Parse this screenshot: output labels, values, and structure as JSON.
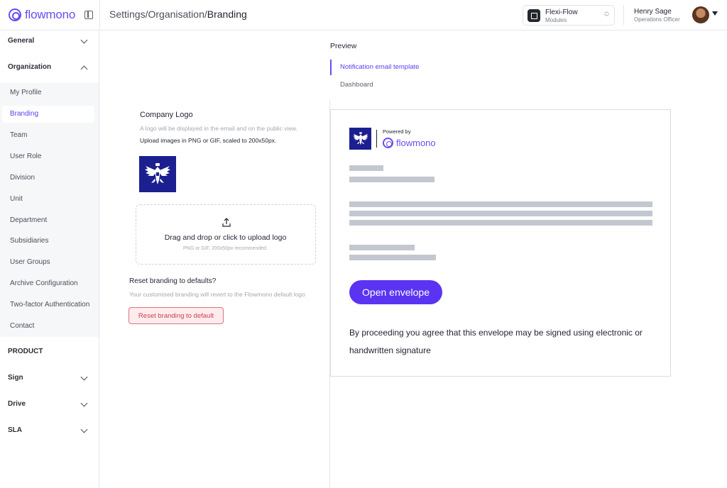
{
  "header": {
    "brand": "flowmono",
    "breadcrumb": [
      "Settings",
      "/",
      "Organisation",
      "/",
      "Branding"
    ],
    "module": {
      "name": "Flexi-Flow",
      "sub": "Modules"
    },
    "user": {
      "name": "Henry Sage",
      "role": "Operations Officer"
    }
  },
  "sidebar": {
    "general": "General",
    "organization": "Organization",
    "items": [
      "My Profile",
      "Branding",
      "Team",
      "User Role",
      "Division",
      "Unit",
      "Department",
      "Subsidiaries",
      "User Groups",
      "Archive Configuration",
      "Two-factor Authentication",
      "Contact"
    ],
    "active_item": "Branding",
    "product": "PRODUCT",
    "sign": "Sign",
    "drive": "Drive",
    "sla": "SLA"
  },
  "branding": {
    "logo_title": "Company Logo",
    "logo_help": "A logo will be displayed in the email and on the public view.",
    "logo_help2": "Upload images in PNG or GIF, scaled to 200x50px.",
    "drop_title": "Drag and drop or click to upload logo",
    "drop_sub": "PNG or GIF, 200x50px recommended.",
    "reset_title": "Reset branding to defaults?",
    "reset_help": "Your customised branding will revert to the Flowmono default logo",
    "reset_button": "Reset branding to default"
  },
  "preview": {
    "label": "Preview",
    "tabs": [
      "Notification email template",
      "Dashboard"
    ],
    "active_tab": "Notification email template",
    "email": {
      "powered_by": "Powered by",
      "brand": "flowmono",
      "button": "Open envelope",
      "consent": "By proceeding you agree that this envelope may be signed using electronic or handwritten signature"
    }
  },
  "colors": {
    "accent": "#6c4cf1",
    "button": "#5a34f2",
    "danger": "#d13e4a",
    "logo_bg": "#1c1f8f"
  },
  "icons": [
    "sidebar-toggle-icon",
    "module-icon",
    "chevron-down-icon",
    "chevron-up-icon",
    "upload-icon",
    "caret-down-icon"
  ]
}
